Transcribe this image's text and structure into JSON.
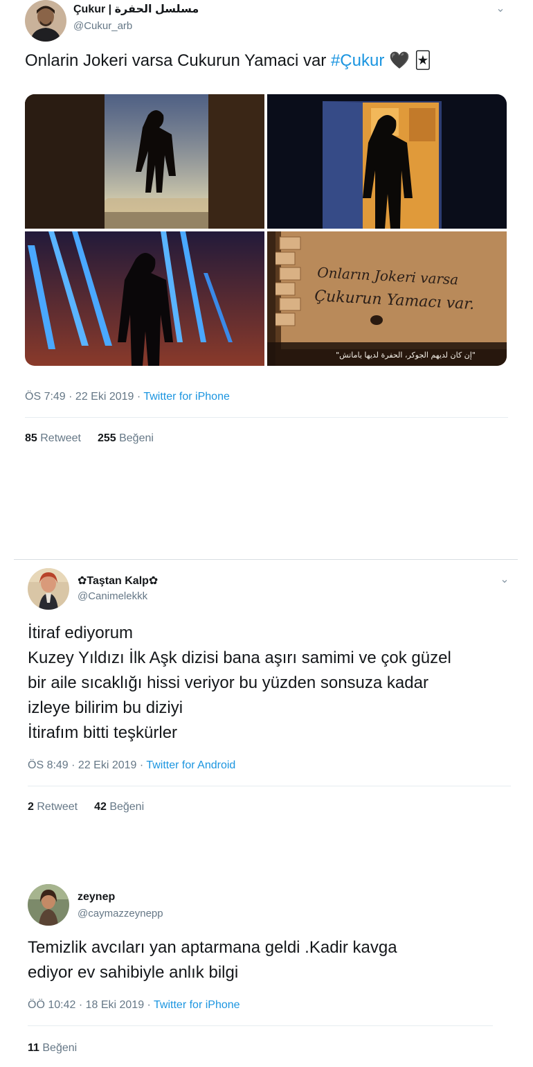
{
  "tweets": [
    {
      "name": "Çukur | مسلسل الحفرة",
      "handle": "@Cukur_arb",
      "text_before": "Onlarin Jokeri varsa Cukurun Yamaci var ",
      "hashtag": "#Çukur",
      "emoji": "🖤 🃏",
      "time": "ÖS 7:49 · 22 Eki 2019 · ",
      "source": "Twitter for iPhone",
      "retweets": "85",
      "retweet_label": "Retweet",
      "likes": "255",
      "likes_label": "Beğeni",
      "media": {
        "wall_line1": "Onların Jokeri varsa",
        "wall_line2": "Çukurun Yamacı var.",
        "subtitle": "\"إن كان لديهم الجوكر، الحفرة لديها ياماتش\""
      }
    },
    {
      "name": "✿Taştan Kalp✿",
      "handle": "@Canimelekkk",
      "lines": [
        "İtiraf ediyorum",
        "Kuzey Yıldızı İlk Aşk dizisi bana aşırı samimi ve çok güzel",
        "bir aile sıcaklığı hissi veriyor bu yüzden sonsuza kadar",
        "izleye bilirim bu diziyi",
        "İtirafım bitti teşkürler"
      ],
      "time": "ÖS 8:49 · 22 Eki 2019 · ",
      "source": "Twitter for Android",
      "retweets": "2",
      "retweet_label": "Retweet",
      "likes": "42",
      "likes_label": "Beğeni"
    },
    {
      "name": "zeynep",
      "handle": "@caymazzeynepp",
      "lines": [
        "Temizlik avcıları yan aptarmana geldi .Kadir kavga",
        "ediyor ev sahibiyle anlık bilgi"
      ],
      "time": "ÖÖ 10:42 · 18 Eki 2019 · ",
      "source": "Twitter for iPhone",
      "likes": "11",
      "likes_label": "Beğeni"
    }
  ],
  "icons": {
    "caret": "chevron-down-icon"
  },
  "colors": {
    "link": "#1b95e0",
    "secondary_text": "#657786",
    "divider": "#e6ecf0"
  }
}
